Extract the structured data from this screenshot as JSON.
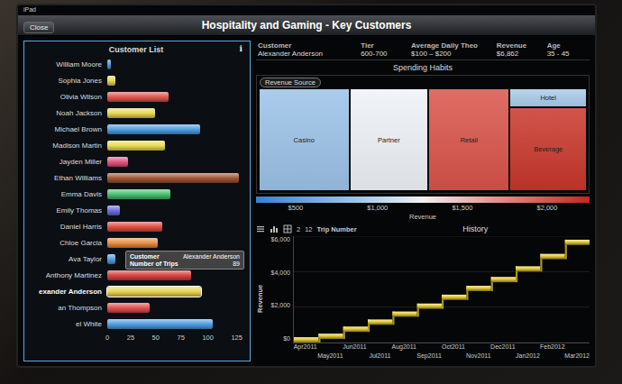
{
  "status_bar": {
    "device": "iPad"
  },
  "toolbar": {
    "close_button": "Close",
    "title": "Hospitality and Gaming - Key Customers"
  },
  "customer_list": {
    "title": "Customer List",
    "info_icon": "ℹ",
    "max": 125,
    "axis_ticks": [
      "0",
      "25",
      "50",
      "75",
      "100",
      "125"
    ],
    "rows": [
      {
        "name": "William Moore",
        "trips": 3,
        "color": "#4f8fd8",
        "selected": false
      },
      {
        "name": "Sophia Jones",
        "trips": 8,
        "color": "#e6d64a",
        "selected": false
      },
      {
        "name": "Olivia Wilson",
        "trips": 58,
        "color": "#e0504a",
        "selected": false
      },
      {
        "name": "Noah Jackson",
        "trips": 45,
        "color": "#e8d94e",
        "selected": false
      },
      {
        "name": "Michael Brown",
        "trips": 88,
        "color": "#4a9be0",
        "selected": false
      },
      {
        "name": "Madison Martin",
        "trips": 55,
        "color": "#e9dc52",
        "selected": false
      },
      {
        "name": "Jayden Miller",
        "trips": 20,
        "color": "#e0507a",
        "selected": false
      },
      {
        "name": "Ethan Williams",
        "trips": 125,
        "color": "#a0502c",
        "selected": false
      },
      {
        "name": "Emma Davis",
        "trips": 60,
        "color": "#3fbf6a",
        "selected": false
      },
      {
        "name": "Emily Thomas",
        "trips": 12,
        "color": "#6a6ae0",
        "selected": false
      },
      {
        "name": "Daniel Harris",
        "trips": 52,
        "color": "#e04a3c",
        "selected": false
      },
      {
        "name": "Chloe Garcia",
        "trips": 48,
        "color": "#e88a3a",
        "selected": false
      },
      {
        "name": "Ava Taylor",
        "trips": 8,
        "color": "#4a9be0",
        "selected": false
      },
      {
        "name": "Anthony Martinez",
        "trips": 80,
        "color": "#d83c3c",
        "selected": false
      },
      {
        "name": "exander Anderson",
        "trips": 89,
        "color": "#e8d24a",
        "selected": true
      },
      {
        "name": "an Thompson",
        "trips": 40,
        "color": "#e04a4a",
        "selected": false
      },
      {
        "name": "el White",
        "trips": 100,
        "color": "#4a9be0",
        "selected": false
      }
    ],
    "tooltip": [
      {
        "label": "Customer",
        "value": "Alexander Anderson"
      },
      {
        "label": "Number of Trips",
        "value": "89"
      }
    ]
  },
  "details": [
    {
      "label": "Customer",
      "value": "Alexander Anderson"
    },
    {
      "label": "Tier",
      "value": "600-700"
    },
    {
      "label": "Average Daily Theo",
      "value": "$100 – $200"
    },
    {
      "label": "Revenue",
      "value": "$6,862"
    },
    {
      "label": "Age",
      "value": "35 - 45"
    }
  ],
  "spending": {
    "title": "Spending Habits",
    "chip": "Revenue Source",
    "columns": [
      [
        {
          "label": "Casino",
          "value": 1900,
          "color": "#9cc3e8"
        }
      ],
      [
        {
          "label": "Partner",
          "value": 1650,
          "color": "#eef2f7"
        }
      ],
      [
        {
          "label": "Retail",
          "value": 1700,
          "color": "#d9544a"
        }
      ],
      [
        {
          "label": "Hotel",
          "value": 280,
          "color": "#a9cdea"
        },
        {
          "label": "Beverage",
          "value": 1332,
          "color": "#c9372c"
        }
      ]
    ]
  },
  "legend": {
    "ticks": [
      "$500",
      "$1,000",
      "$1,500",
      "$2,000"
    ],
    "title": "Revenue"
  },
  "history": {
    "trip_label": "Trip Number",
    "trip_from": "2",
    "trip_to": "12",
    "title": "History",
    "axis_title": "Revenue",
    "y_ticks": [
      "$6,000",
      "$4,000",
      "$2,000",
      "$0"
    ],
    "y_max": 6000,
    "months": [
      "Apr2011",
      "May2011",
      "Jun2011",
      "Jul2011",
      "Aug2011",
      "Sep2011",
      "Oct2011",
      "Nov2011",
      "Dec2011",
      "Jan2012",
      "Feb2012",
      "Mar2012"
    ],
    "series": [
      {
        "name": "Revenue",
        "values": [
          150,
          500,
          900,
          1300,
          1750,
          2200,
          2700,
          3200,
          3700,
          4300,
          5000,
          5800
        ]
      }
    ]
  }
}
